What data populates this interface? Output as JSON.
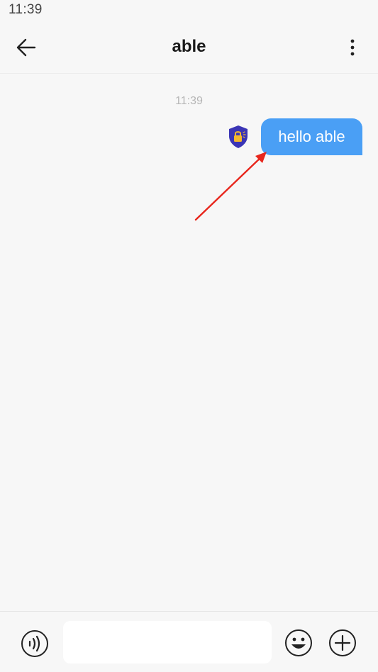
{
  "status_bar": {
    "time": "11:39"
  },
  "header": {
    "title": "able",
    "back_icon": "arrow-left-icon",
    "more_icon": "more-vertical-icon"
  },
  "chat": {
    "timestamp": "11:39",
    "messages": [
      {
        "direction": "outgoing",
        "text": "hello able",
        "status_icon": "secure-lock-shield-icon"
      }
    ]
  },
  "composer": {
    "input_value": "",
    "voice_icon": "voice-input-icon",
    "emoji_icon": "emoji-icon",
    "plus_icon": "plus-icon"
  },
  "colors": {
    "bubble": "#4a9ff5",
    "background": "#f7f7f7",
    "shield": "#3b35b5",
    "lock": "#f5b82e",
    "annotation_arrow": "#e8261c"
  }
}
